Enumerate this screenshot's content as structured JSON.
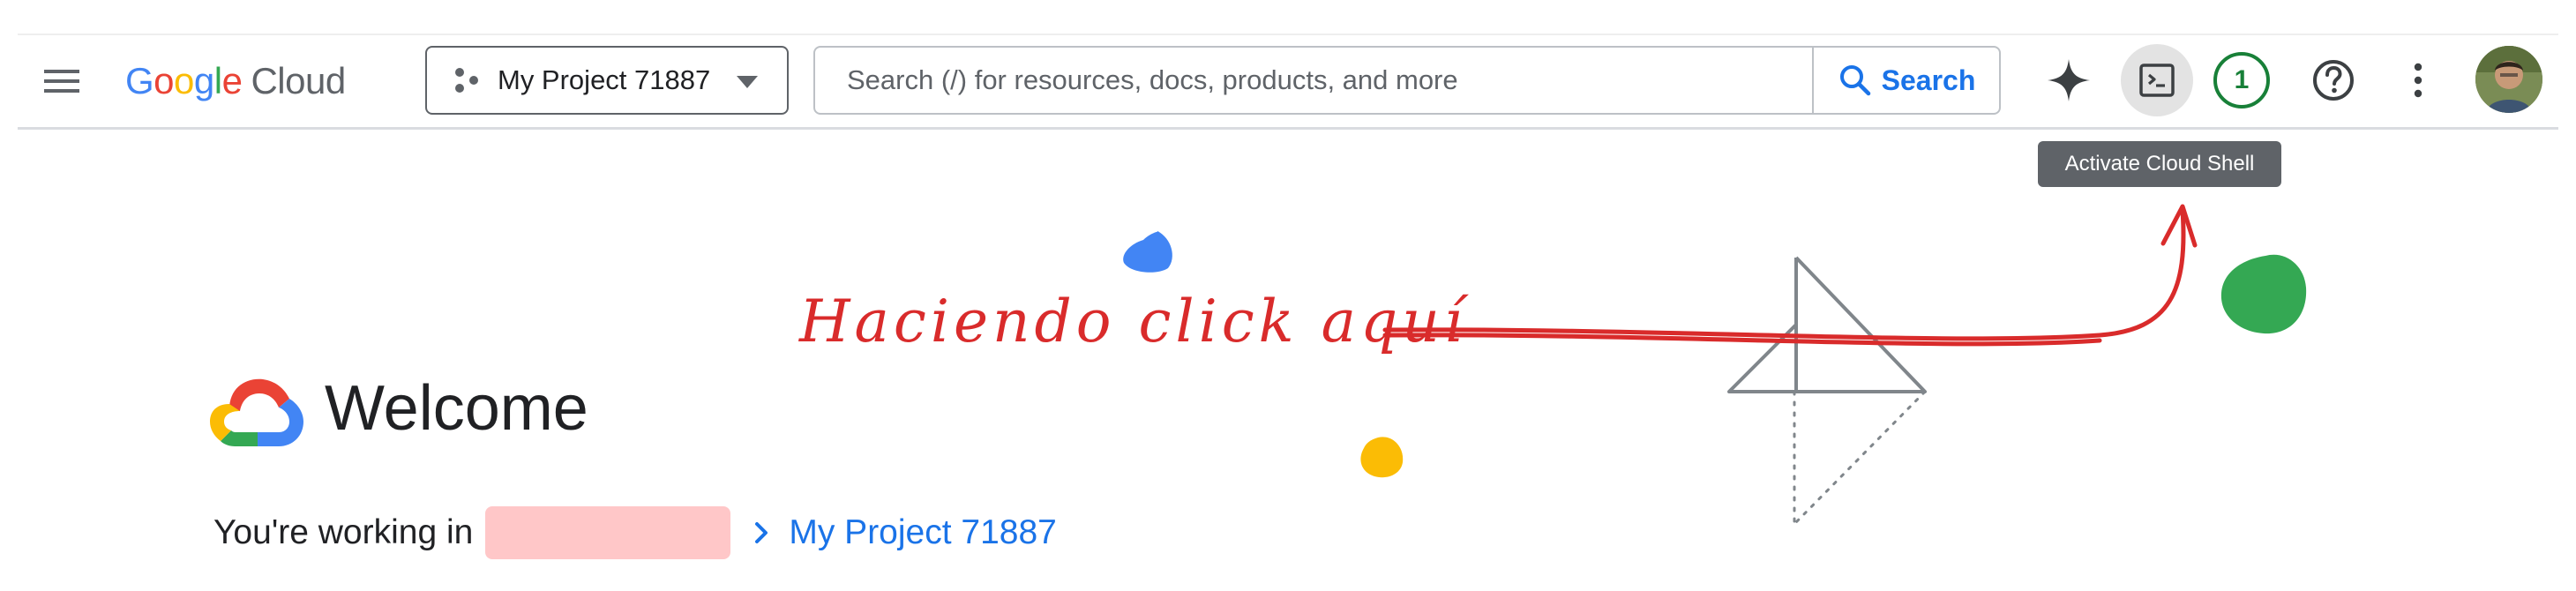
{
  "header": {
    "menu_icon": "hamburger-menu-icon",
    "logo": {
      "google": [
        "G",
        "o",
        "o",
        "g",
        "l",
        "e"
      ],
      "cloud": "Cloud"
    },
    "project_picker": {
      "label": "My Project 71887",
      "icon": "project-nodes-icon",
      "caret_icon": "caret-down-icon"
    },
    "search": {
      "placeholder": "Search (/) for resources, docs, products, and more",
      "value": "",
      "button_label": "Search",
      "icon": "search-icon"
    },
    "actions": {
      "gemini_icon": "gemini-sparkle-icon",
      "cloud_shell_icon": "terminal-icon",
      "notifications_count": "1",
      "help_icon": "help-circle-icon",
      "more_icon": "more-vert-icon",
      "avatar_icon": "user-avatar"
    },
    "tooltip": "Activate Cloud Shell"
  },
  "annotation": {
    "text": "Haciendo click aquí",
    "color": "#d92b2b"
  },
  "welcome": {
    "logo_icon": "google-cloud-logo-icon",
    "title": "Welcome",
    "working_in_label": "You're working in",
    "organization": "",
    "chevron_icon": "chevron-right-icon",
    "project_link": "My Project 71887"
  },
  "colors": {
    "google_blue": "#4285f4",
    "google_red": "#ea4335",
    "google_yellow": "#fbbc05",
    "google_green": "#34a853",
    "link_blue": "#1a73e8",
    "notif_green": "#188038",
    "redaction_pink": "#ffc7c8"
  }
}
